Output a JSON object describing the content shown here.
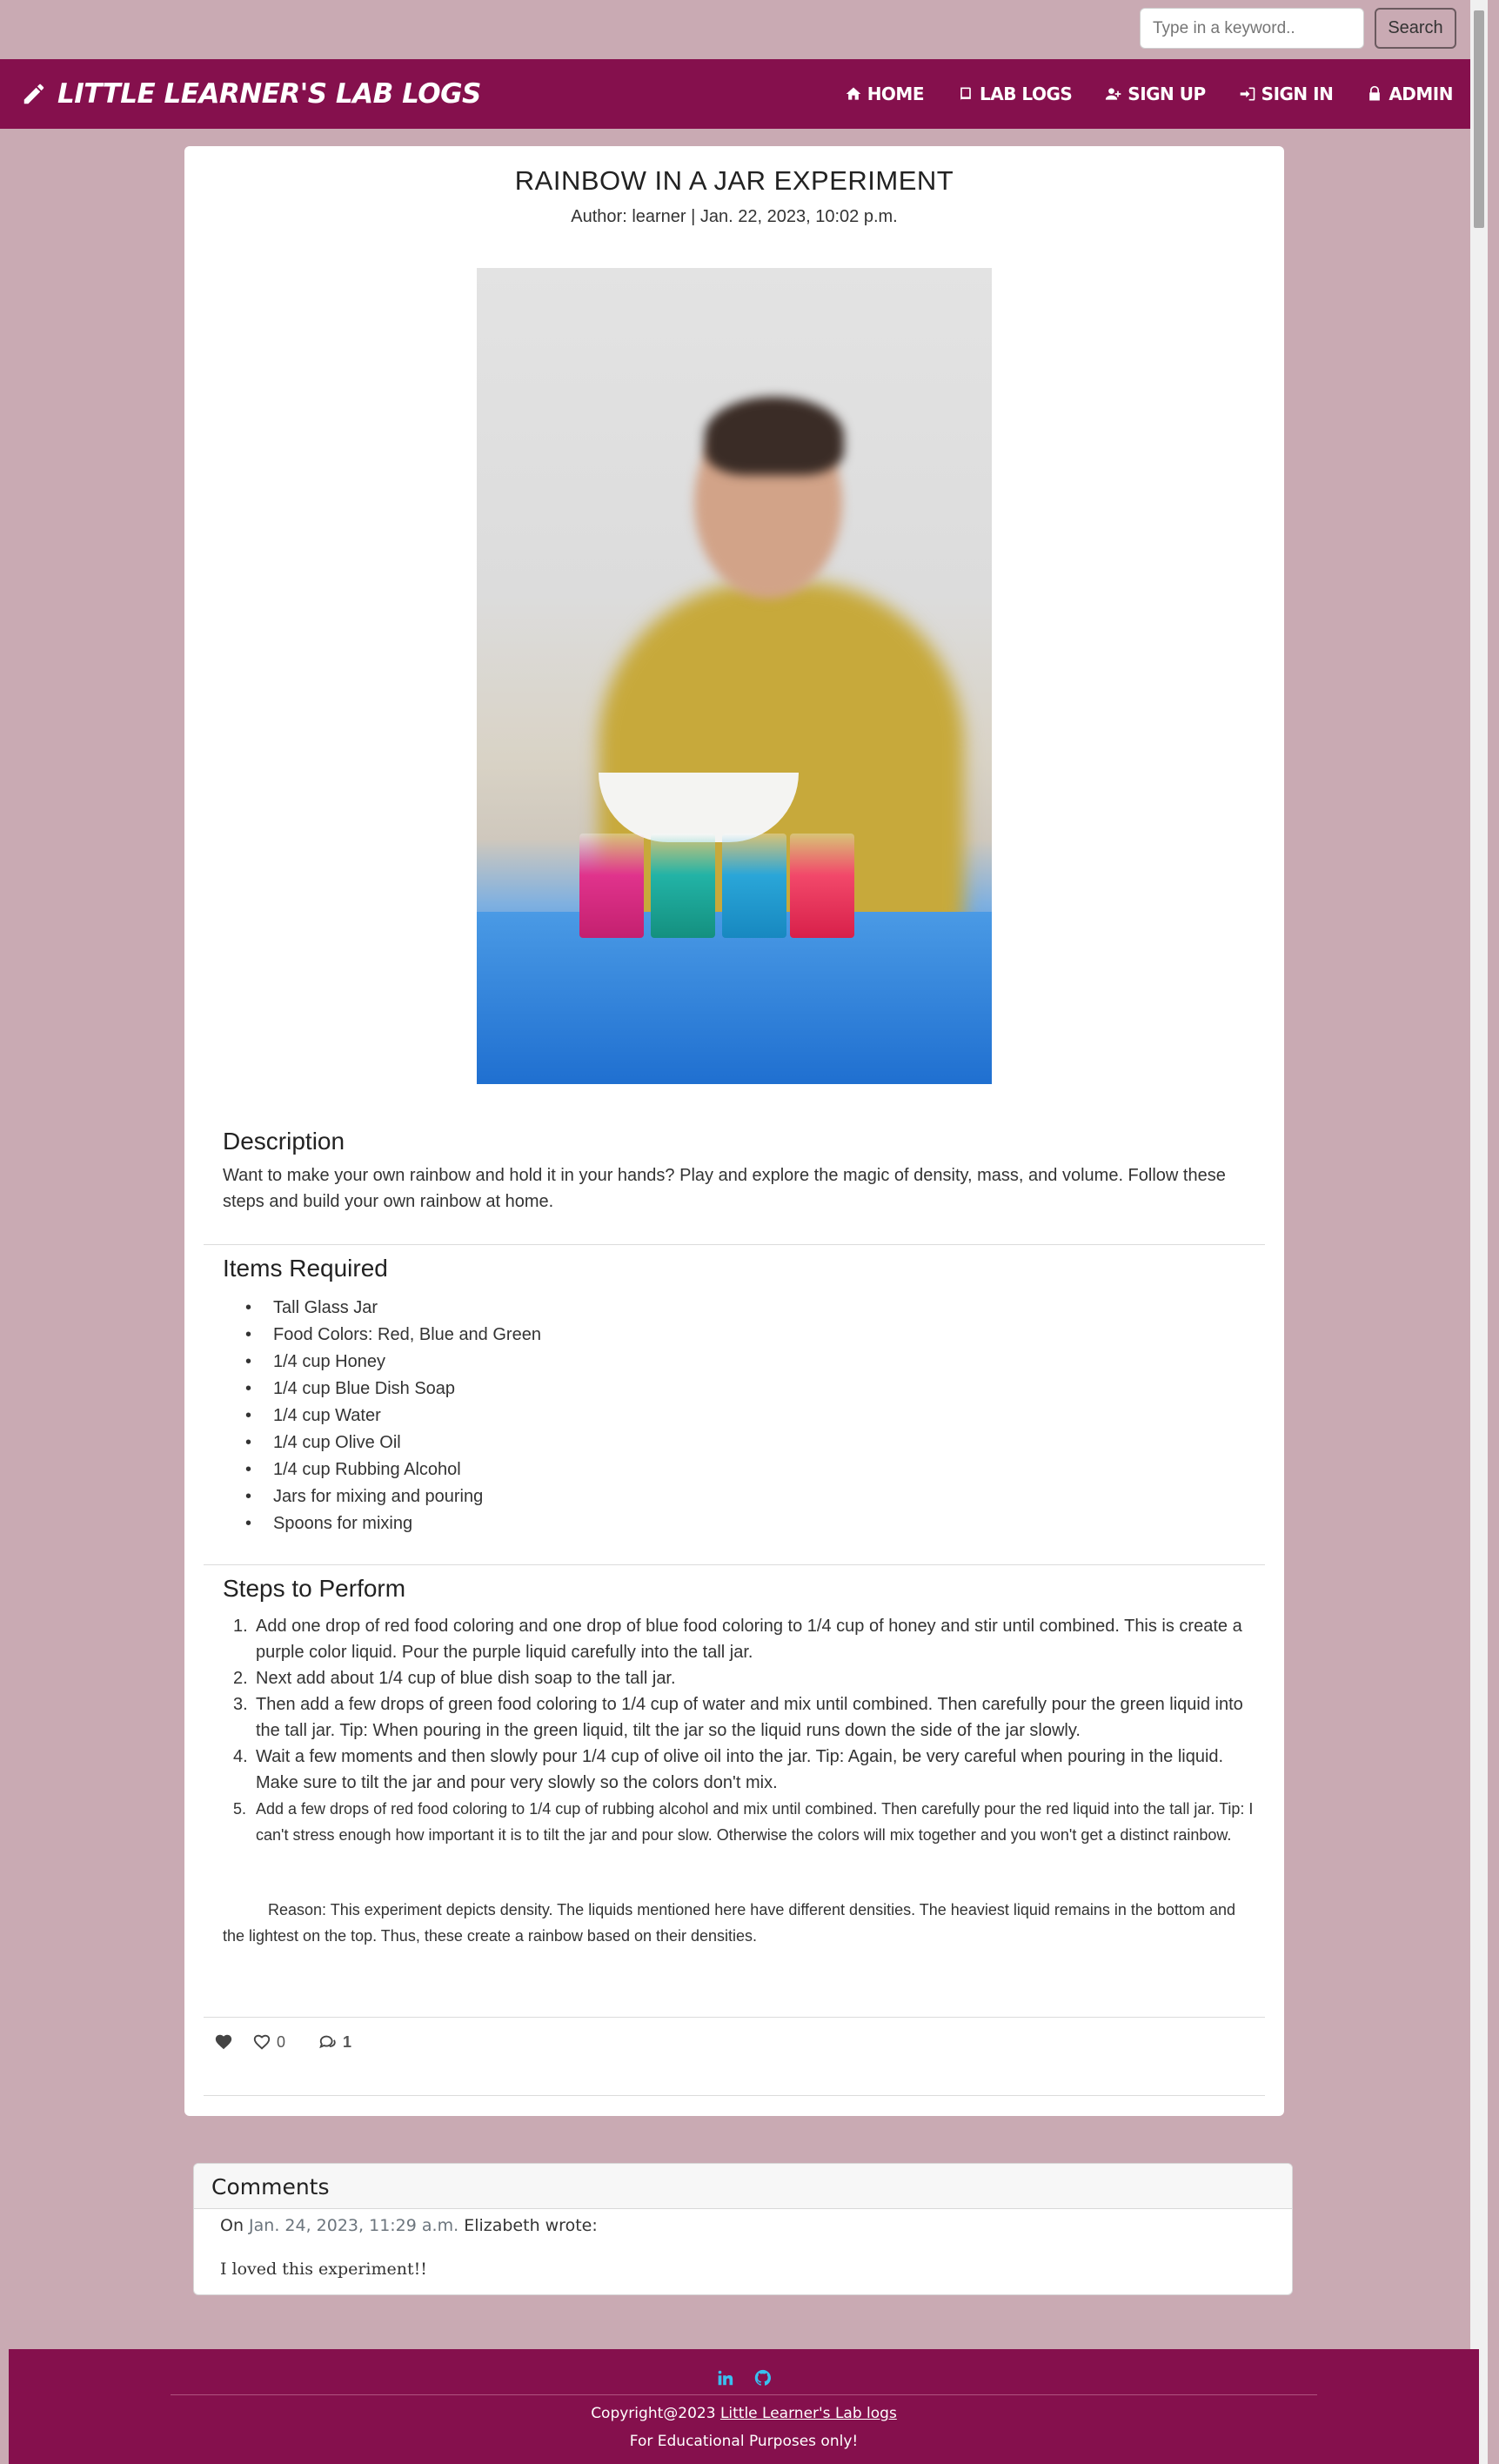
{
  "search": {
    "placeholder": "Type in a keyword..",
    "button_label": "Search"
  },
  "navbar": {
    "brand": "LITTLE LEARNER'S LAB LOGS",
    "brand_icon": "pencil-icon",
    "items": [
      {
        "label": "HOME",
        "icon": "home-icon"
      },
      {
        "label": "LAB LOGS",
        "icon": "book-icon"
      },
      {
        "label": "SIGN UP",
        "icon": "user-plus-icon"
      },
      {
        "label": "SIGN IN",
        "icon": "sign-in-icon"
      },
      {
        "label": "ADMIN",
        "icon": "lock-icon"
      }
    ]
  },
  "post": {
    "title": "RAINBOW IN A JAR EXPERIMENT",
    "meta": "Author: learner | Jan. 22, 2023, 10:02 p.m.",
    "description_title": "Description",
    "description": "Want to make your own rainbow and hold it in your hands? Play and explore the magic of density, mass, and volume. Follow these steps and build your own rainbow at home.",
    "items_title": "Items Required",
    "items": [
      "Tall Glass Jar",
      "Food Colors: Red, Blue and Green",
      "1/4 cup Honey",
      "1/4 cup Blue Dish Soap",
      "1/4 cup Water",
      "1/4 cup Olive Oil",
      "1/4 cup Rubbing Alcohol",
      "Jars for mixing and pouring",
      "Spoons for mixing"
    ],
    "steps_title": "Steps to Perform",
    "steps": [
      {
        "num": "1",
        "text": "Add one drop of red food coloring and one drop of blue food coloring to 1/4 cup of honey and stir until combined. This is create a purple color liquid. Pour the purple liquid carefully into the tall jar."
      },
      {
        "num": "2",
        "text": "Next add about 1/4 cup of blue dish soap to the tall jar."
      },
      {
        "num": "3",
        "text": "Then add a few drops of green food coloring to 1/4 cup of water and mix until combined. Then carefully pour the green liquid into the tall jar. Tip: When pouring in the green liquid, tilt the jar so the liquid runs down the side of the jar slowly."
      },
      {
        "num": "4",
        "text": "Wait a few moments and then slowly pour 1/4 cup of olive oil into the jar. Tip: Again, be very careful when pouring in the liquid. Make sure to tilt the jar and pour very slowly so the colors don't mix."
      },
      {
        "num": "5",
        "text": "Add a few drops of red food coloring to 1/4 cup of rubbing alcohol and mix until combined. Then carefully pour the red liquid into the tall jar. Tip: I can't stress enough how important it is to tilt the jar and pour slow. Otherwise the colors will mix together and you won't get a distinct rainbow."
      }
    ],
    "reason": "Reason: This experiment depicts density. The liquids mentioned here have different densities. The heaviest liquid remains in the bottom and the lightest on the top. Thus, these create a rainbow based on their densities.",
    "likes_count": "0",
    "comments_count": "1"
  },
  "comments": {
    "title": "Comments",
    "items": [
      {
        "prefix": "On",
        "date": "Jan. 24, 2023, 11:29 a.m.",
        "author_line": "Elizabeth wrote:",
        "body": "I loved this experiment!!"
      }
    ]
  },
  "footer": {
    "copyright_prefix": "Copyright@2023",
    "copyright_link": "Little Learner's Lab logs",
    "note": "For Educational Purposes only!",
    "icons": [
      "linkedin-icon",
      "github-icon"
    ]
  },
  "colors": {
    "brand": "#85104d",
    "background": "#c9aab3",
    "footer_icon": "#39c0f0"
  }
}
